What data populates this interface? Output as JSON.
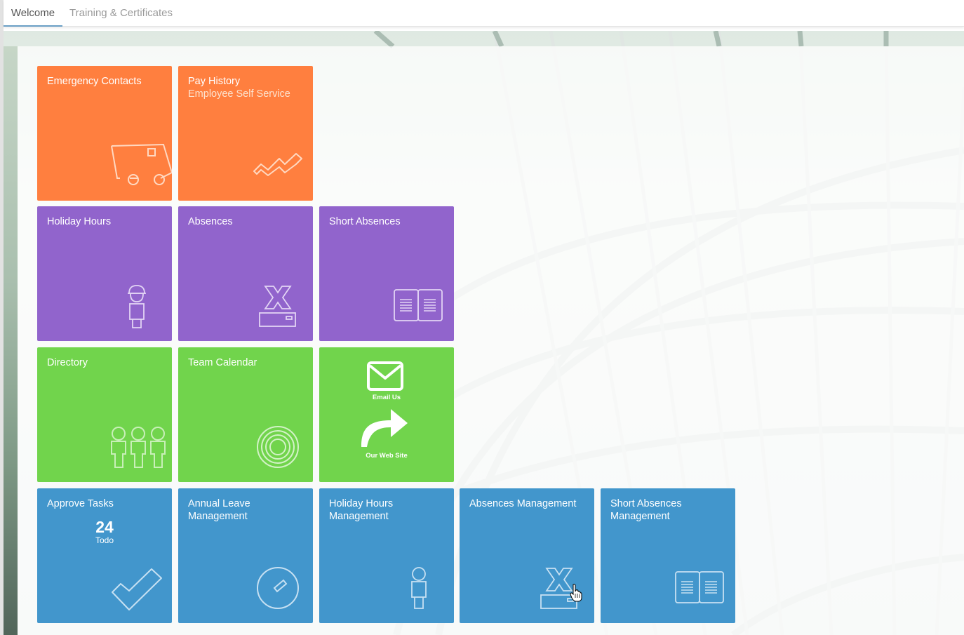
{
  "tabs": [
    {
      "label": "Welcome",
      "active": true
    },
    {
      "label": "Training & Certificates",
      "active": false
    }
  ],
  "colors": {
    "orange": "#ff7f3f",
    "purple": "#9164cc",
    "green": "#71d44c",
    "blue": "#4296cc",
    "tab_underline": "#6a9fc5"
  },
  "tiles": {
    "emergency_contacts": {
      "title": "Emergency Contacts",
      "icon": "truck-icon"
    },
    "pay_history": {
      "title": "Pay History",
      "subtitle": "Employee Self Service",
      "icon": "trend-chart-icon"
    },
    "holiday_hours": {
      "title": "Holiday Hours",
      "icon": "worker-hardhat-icon"
    },
    "absences": {
      "title": "Absences",
      "icon": "x-tray-icon"
    },
    "short_absences": {
      "title": "Short Absences",
      "icon": "open-book-icon"
    },
    "directory": {
      "title": "Directory",
      "icon": "people-group-icon"
    },
    "team_calendar": {
      "title": "Team Calendar",
      "icon": "target-circles-icon"
    },
    "links": {
      "email_label": "Email Us",
      "email_icon": "envelope-icon",
      "web_label": "Our Web Site",
      "web_icon": "share-arrow-icon"
    },
    "approve_tasks": {
      "title": "Approve Tasks",
      "count": "24",
      "count_label": "Todo",
      "icon": "checkmark-icon"
    },
    "annual_leave_management": {
      "title": "Annual Leave Management",
      "icon": "gauge-icon"
    },
    "holiday_hours_management": {
      "title": "Holiday Hours Management",
      "icon": "person-icon"
    },
    "absences_management": {
      "title": "Absences Management",
      "icon": "x-tray-icon"
    },
    "short_absences_management": {
      "title": "Short Absences Management",
      "icon": "open-book-icon"
    }
  }
}
